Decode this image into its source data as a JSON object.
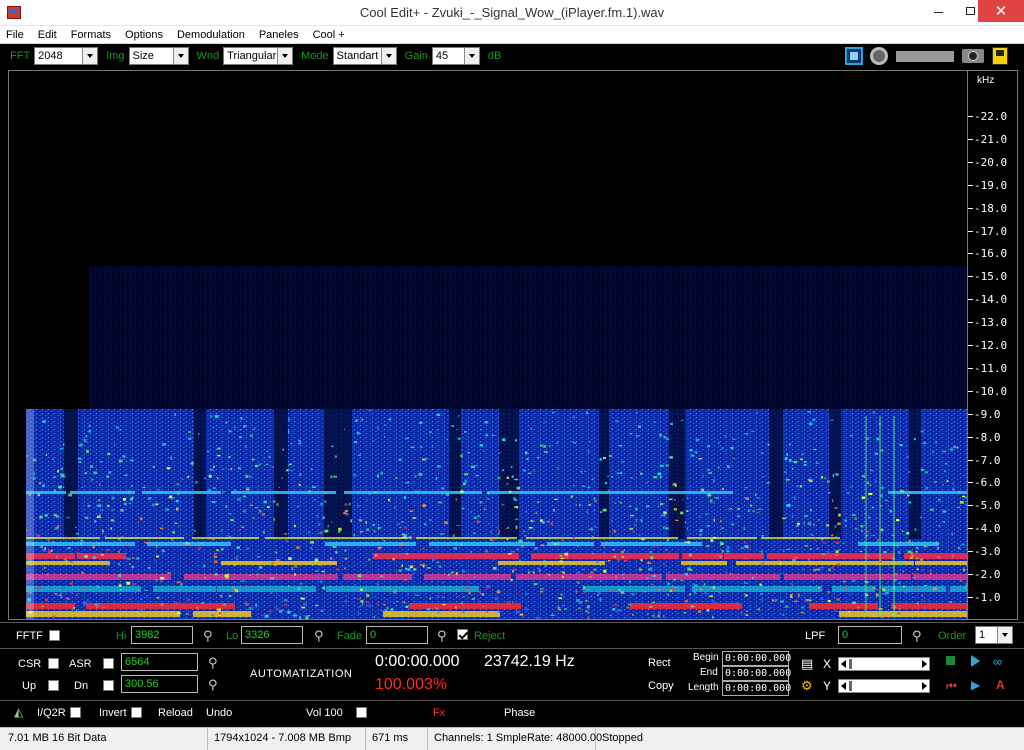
{
  "window": {
    "title": "Cool Edit+ - Zvuki_-_Signal_Wow_(iPlayer.fm.1).wav",
    "close_glyph": "✕"
  },
  "menu": [
    "File",
    "Edit",
    "Formats",
    "Options",
    "Demodulation",
    "Paneles",
    "Cool +"
  ],
  "fft_toolbar": {
    "fft_label": "FFT",
    "fft_value": "2048",
    "img_label": "Img",
    "img_value": "Size",
    "wnd_label": "Wnd",
    "wnd_value": "Triangular",
    "mode_label": "Mode",
    "mode_value": "Standart",
    "gain_label": "Gain",
    "gain_value": "45",
    "gain_unit": "dB"
  },
  "spectrogram": {
    "unit": "kHz",
    "ticks": [
      "22.0",
      "21.0",
      "20.0",
      "19.0",
      "18.0",
      "17.0",
      "16.0",
      "15.0",
      "14.0",
      "13.0",
      "12.0",
      "11.0",
      "10.0",
      "9.0",
      "8.0",
      "7.0",
      "6.0",
      "5.0",
      "4.0",
      "3.0",
      "2.0",
      "1.0"
    ]
  },
  "filter_row": {
    "fftf_label": "FFTF",
    "fftf_checked": false,
    "hi_label": "Hi",
    "hi_value": "3982",
    "lo_label": "Lo",
    "lo_value": "3326",
    "fade_label": "Fade",
    "fade_value": "0",
    "reject_label": "Reject",
    "reject_checked": true,
    "lpf_label": "LPF",
    "lpf_value": "0",
    "order_label": "Order",
    "order_value": "1"
  },
  "auto_row": {
    "csr_label": "CSR",
    "asr_label": "ASR",
    "asr_value": "6564",
    "up_label": "Up",
    "dn_label": "Dn",
    "dn_value": "300.56",
    "automatization": "AUTOMATIZATION",
    "time": "0:00:00.000",
    "frequency": "23742.19 Hz",
    "percent": "100.003%",
    "rect_label": "Rect",
    "copy_label": "Copy",
    "begin_label": "Begin",
    "begin_value": "0:00:00.000",
    "end_label": "End",
    "end_value": "0:00:00.000",
    "length_label": "Length",
    "length_value": "0:00:00.000",
    "x_label": "X",
    "y_label": "Y"
  },
  "bottom_row": {
    "iq_label": "I/Q2R",
    "invert_label": "Invert",
    "reload_label": "Reload",
    "undo_label": "Undo",
    "vol_label": "Vol 100",
    "fx_label": "Fx",
    "phase_label": "Phase"
  },
  "status": {
    "data": "7.01 MB 16 Bit Data",
    "bmp": "1794x1024 - 7.008 MB Bmp",
    "ms": "671 ms",
    "channels": "Channels: 1  SmpleRate: 48000.00",
    "state": "Stopped"
  },
  "colors": {
    "green_label": "#129a1c",
    "value_green": "#1ed11e",
    "accent_red": "#ff2a2a",
    "close_red": "#e04343"
  }
}
